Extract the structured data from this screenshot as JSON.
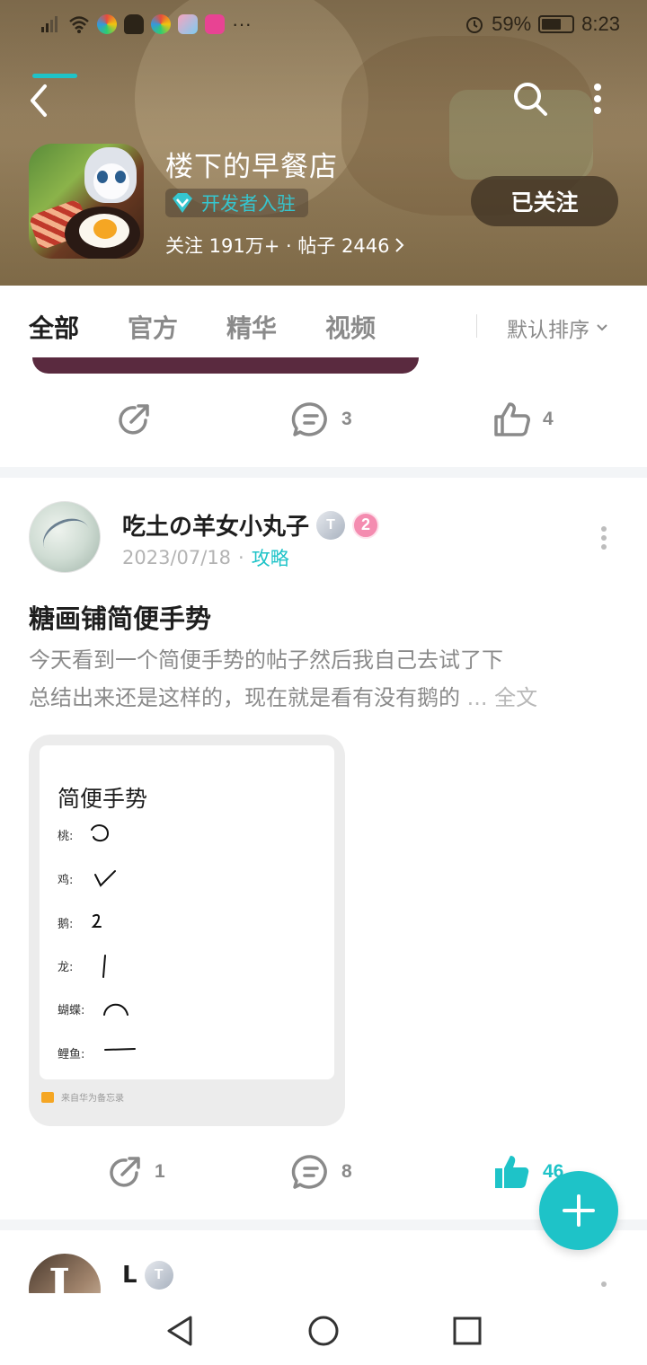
{
  "status_bar": {
    "battery_text": "59%",
    "time": "8:23",
    "battery_level": 0.59
  },
  "header": {
    "game_title": "楼下的早餐店",
    "dev_badge": "开发者入驻",
    "stats": "关注 191万+ · 帖子 2446",
    "follow_label": "已关注",
    "accent_color": "#35c6cf"
  },
  "tabs": {
    "items": [
      {
        "label": "全部",
        "active": true
      },
      {
        "label": "官方",
        "active": false
      },
      {
        "label": "精华",
        "active": false
      },
      {
        "label": "视频",
        "active": false
      }
    ],
    "sort_label": "默认排序"
  },
  "prev_post": {
    "comment_count": "3",
    "like_count": "4"
  },
  "post": {
    "author": "吃土の羊女小丸子",
    "level_badge": "T",
    "rank_badge": "2",
    "date": "2023/07/18",
    "dot": "·",
    "tag": "攻略",
    "title": "糖画铺简便手势",
    "body_line1": "今天看到一个简便手势的帖子然后我自己去试了下",
    "body_line2": "总结出来还是这样的，现在就是看有没有鹅的",
    "ellipsis": " ... ",
    "full_text": "全文",
    "image": {
      "title": "简便手势",
      "items": [
        {
          "label": "桃:"
        },
        {
          "label": "鸡:"
        },
        {
          "label": "鹅:"
        },
        {
          "label": "龙:"
        },
        {
          "label": "蝴蝶:"
        },
        {
          "label": "鲤鱼:"
        }
      ],
      "footer": "来自华为备忘录"
    },
    "share_count": "1",
    "comment_count": "8",
    "like_count": "46"
  },
  "next_post": {
    "author": "L",
    "level_badge": "T"
  },
  "colors": {
    "accent": "#1ec3c8",
    "text_primary": "#1e1e1e",
    "text_secondary": "#8a8a8a"
  }
}
